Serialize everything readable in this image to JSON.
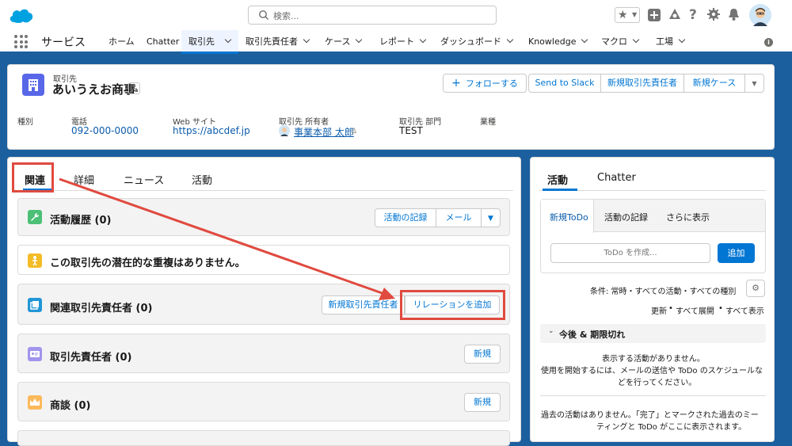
{
  "search": {
    "placeholder": "検索..."
  },
  "nav": {
    "app_name": "サービス",
    "items": [
      "ホーム",
      "Chatter",
      "取引先",
      "取引先責任者",
      "ケース",
      "レポート",
      "ダッシュボード",
      "Knowledge",
      "マクロ",
      "工場"
    ],
    "info": "i"
  },
  "record": {
    "object_label": "取引先",
    "name": "あいうえお商事",
    "actions": {
      "follow": "フォローする",
      "slack": "Send to Slack",
      "new_contact": "新規取引先責任者",
      "new_case": "新規ケース"
    },
    "fields": [
      {
        "label": "種別",
        "value": ""
      },
      {
        "label": "電話",
        "value": "092-000-0000"
      },
      {
        "label": "Web サイト",
        "value": "https://abcdef.jp"
      },
      {
        "label": "取引先 所有者",
        "value": "事業本部 太郎"
      },
      {
        "label": "取引先 部門",
        "value": "TEST"
      },
      {
        "label": "業種",
        "value": ""
      }
    ]
  },
  "tabs": [
    "関連",
    "詳細",
    "ニュース",
    "活動"
  ],
  "related": {
    "activity_history": {
      "title": "活動履歴 (0)",
      "log_btn": "活動の記録",
      "mail_btn": "メール"
    },
    "duplicates": {
      "title": "この取引先の潜在的な重複はありません。"
    },
    "related_contacts": {
      "title": "関連取引先責任者 (0)",
      "new_btn": "新規取引先責任者",
      "add_rel_btn": "リレーションを追加"
    },
    "contacts": {
      "title": "取引先責任者 (0)",
      "new_btn": "新規"
    },
    "opportunities": {
      "title": "商談 (0)",
      "new_btn": "新規"
    }
  },
  "activity": {
    "tabs": [
      "活動",
      "Chatter"
    ],
    "subtabs": [
      "新規ToDo",
      "活動の記録",
      "さらに表示"
    ],
    "todo_placeholder": "ToDo を作成...",
    "add_btn": "追加",
    "filter_text": "条件: 常時・すべての活動・すべての種別",
    "links": [
      "更新",
      "すべて展開",
      "すべて表示"
    ],
    "section_title": "今後 & 期限切れ",
    "empty_1": "表示する活動がありません。",
    "empty_2": "使用を開始するには、メールの送信や ToDo のスケジュールな",
    "empty_3": "どを行ってください。",
    "past_1": "過去の活動はありません。「完了」とマークされた過去のミー",
    "past_2": "ティングと ToDo がここに表示されます。"
  },
  "colors": {
    "brand": "#0176d3",
    "annotation": "#e04a3f",
    "background": "#1b5f9e"
  }
}
